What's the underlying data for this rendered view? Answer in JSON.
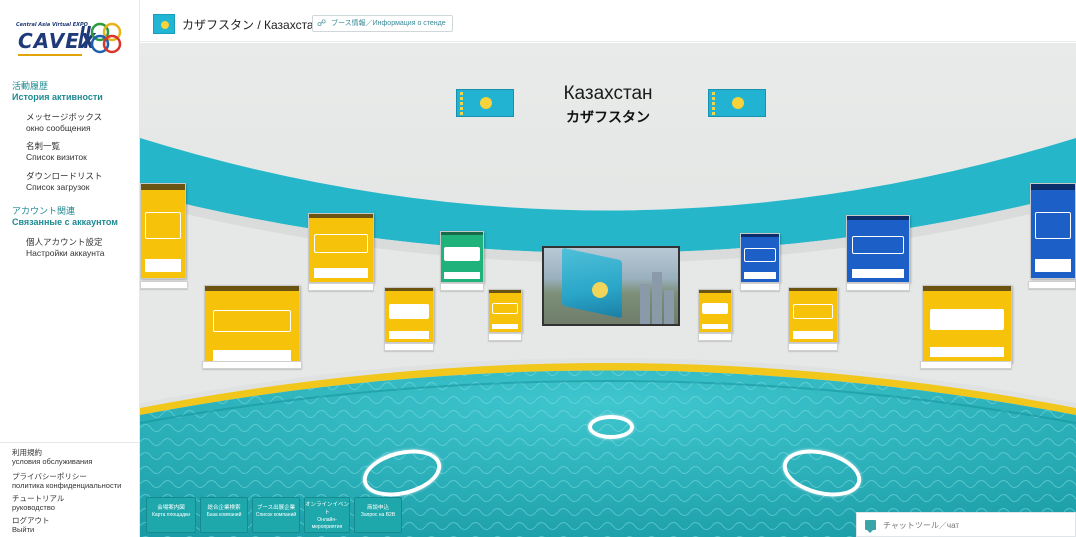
{
  "logo": {
    "tagline": "Central Asia Virtual EXPO",
    "name": "CAVEX"
  },
  "sidebar": {
    "activity": {
      "jp": "活動履歴",
      "ru": "История активности",
      "items": [
        {
          "jp": "メッセージボックス",
          "ru": "окно сообщения"
        },
        {
          "jp": "名刺一覧",
          "ru": "Список визиток"
        },
        {
          "jp": "ダウンロードリスト",
          "ru": "Список загрузок"
        }
      ]
    },
    "account": {
      "jp": "アカウント関連",
      "ru": "Связанные с аккаунтом",
      "items": [
        {
          "jp": "個人アカウント設定",
          "ru": "Настройки аккаунта"
        }
      ]
    },
    "footer": [
      {
        "jp": "利用規約",
        "ru": "условия обслуживания"
      },
      {
        "jp": "プライバシーポリシー",
        "ru": "политика конфиденциальности"
      },
      {
        "jp": "チュートリアル",
        "ru": "руководство"
      },
      {
        "jp": "ログアウト",
        "ru": "Выйти"
      }
    ]
  },
  "topbar": {
    "title": "カザフスタン / Казахстан",
    "info_button": "ブース情報／Информация о стенде",
    "link_icon": "link-icon"
  },
  "hall": {
    "title_ru": "Казахстан",
    "title_jp": "カザフスタン"
  },
  "bottom_buttons": [
    {
      "jp": "会場案内図",
      "ru": "Карта площадки"
    },
    {
      "jp": "総合企業検索",
      "ru": "База компаний"
    },
    {
      "jp": "ブース出展企業",
      "ru": "Список компаний"
    },
    {
      "jp": "オンラインイベント",
      "ru": "Онлайн-мероприятия"
    },
    {
      "jp": "商談申込",
      "ru": "Запрос на B2B"
    }
  ],
  "chat": {
    "label": "チャットツール／чат",
    "icon": "chat-icon"
  },
  "colors": {
    "accent": "#1ea8ab",
    "teal_band": "#25b7c9",
    "poster_yellow": "#f7c20a",
    "sidebar_heading": "#1e8a92"
  }
}
